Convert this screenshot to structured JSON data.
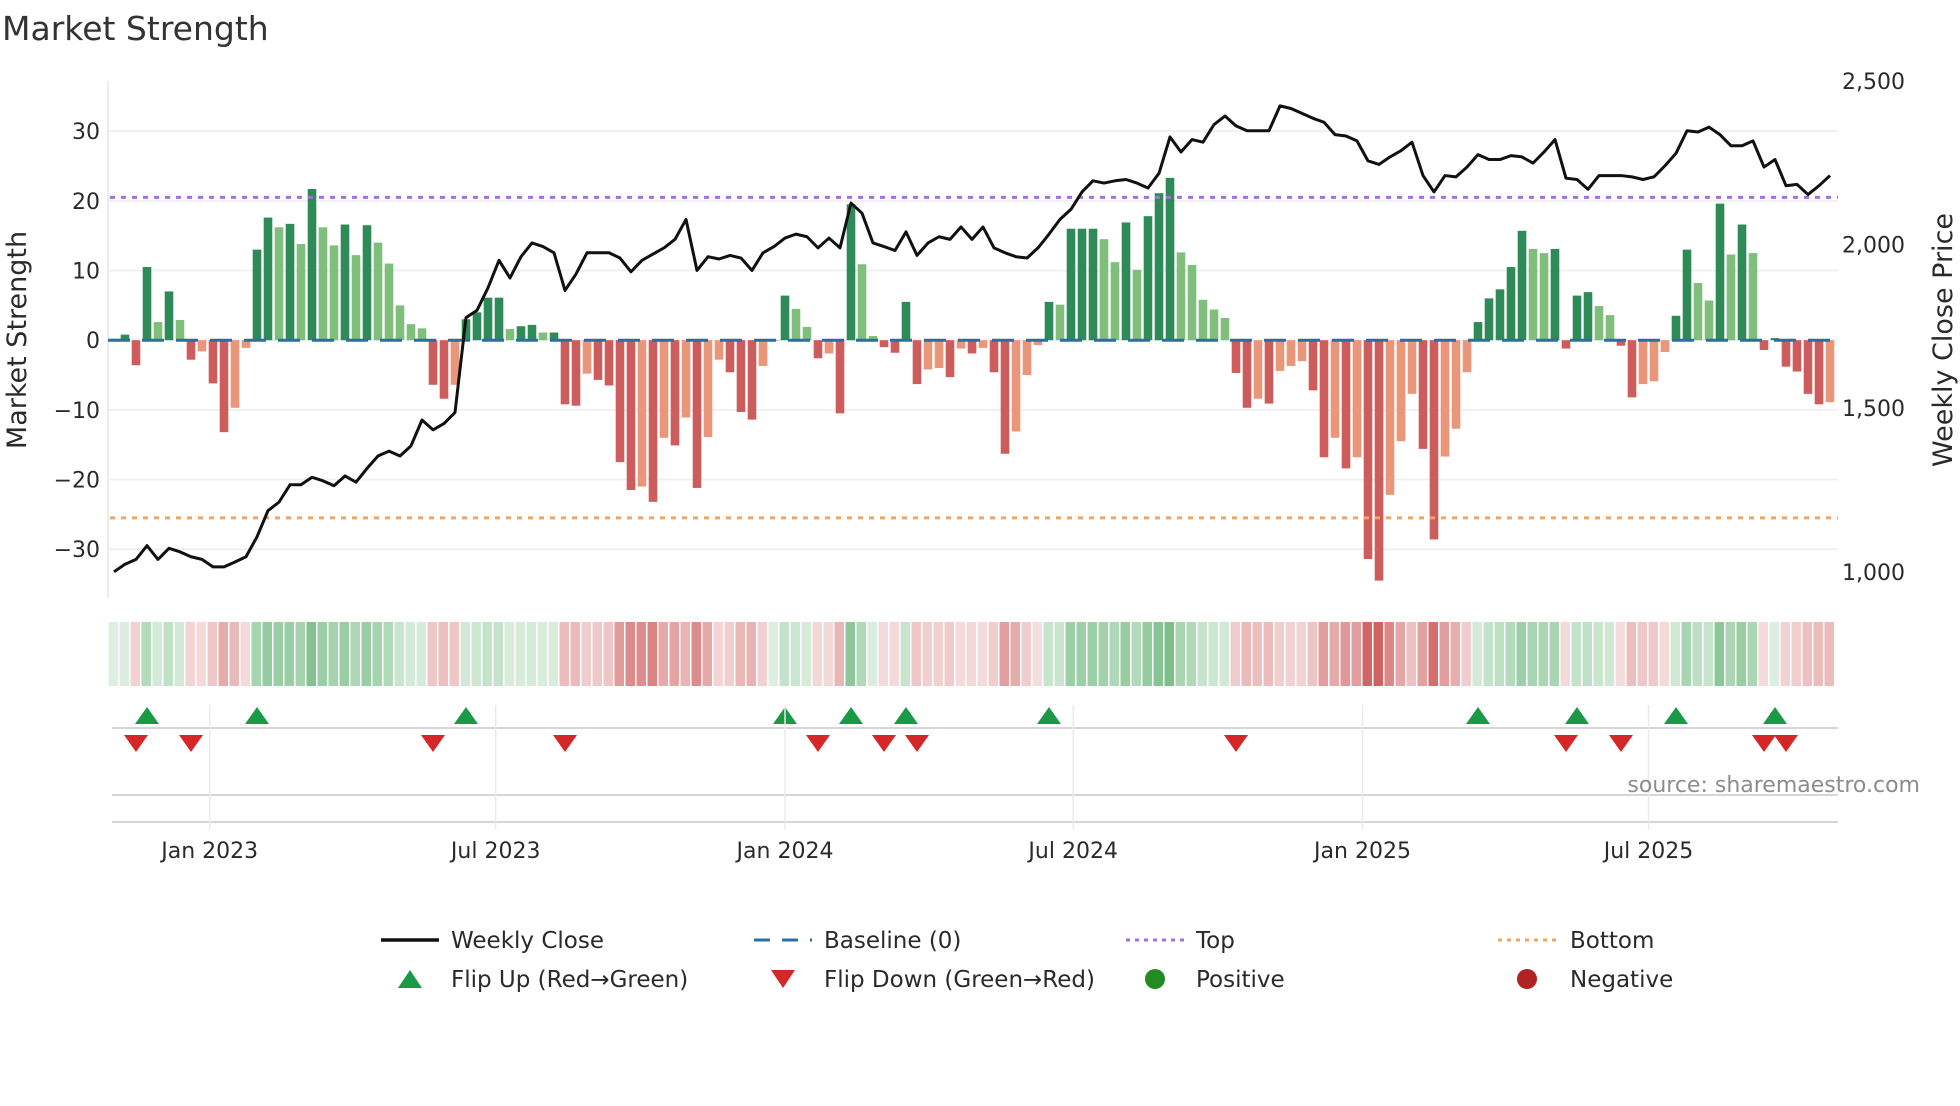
{
  "chart_data": {
    "type": "bar",
    "title": "Market Strength",
    "ylabel": "Market Strength",
    "y2label": "Weekly Close Price",
    "ylim": [
      -37,
      37.2
    ],
    "y2lim": [
      920,
      2500
    ],
    "yticks": [
      30,
      20,
      10,
      0,
      -10,
      -20,
      -30
    ],
    "ytick_labels": [
      "30",
      "20",
      "10",
      "0",
      "−10",
      "−20",
      "−30"
    ],
    "y2ticks": [
      2500,
      2000,
      1500,
      1000
    ],
    "y2tick_labels": [
      "2,500",
      "2,000",
      "1,500",
      "1,000"
    ],
    "x_unit": "week index (weekly bars, starting ~Nov 2022)",
    "xticks": [
      {
        "week": 8.7,
        "label": "Jan 2023"
      },
      {
        "week": 34.7,
        "label": "Jul 2023"
      },
      {
        "week": 61.0,
        "label": "Jan 2024"
      },
      {
        "week": 87.2,
        "label": "Jul 2024"
      },
      {
        "week": 113.5,
        "label": "Jan 2025"
      },
      {
        "week": 139.5,
        "label": "Jul 2025"
      }
    ],
    "top_level": 20.5,
    "bottom_level": -25.5,
    "baseline": 0,
    "strength": [
      0.2,
      0.8,
      -3.6,
      10.5,
      2.6,
      7,
      2.9,
      -2.8,
      -1.6,
      -6.2,
      -13.2,
      -9.7,
      -1.1,
      13,
      17.6,
      16.2,
      16.7,
      13.8,
      21.7,
      16.2,
      13.6,
      16.6,
      12.2,
      16.5,
      14,
      11,
      5,
      2.3,
      1.7,
      -6.4,
      -8.4,
      -6.4,
      3,
      4,
      6.1,
      6.1,
      1.6,
      2,
      2.2,
      1.1,
      1.1,
      -9.2,
      -9.4,
      -4.8,
      -5.7,
      -6.5,
      -17.5,
      -21.5,
      -21,
      -23.2,
      -14,
      -15.1,
      -11.1,
      -21.2,
      -13.9,
      -2.8,
      -4.6,
      -10.3,
      -11.4,
      -3.7,
      0,
      6.4,
      4.5,
      1.9,
      -2.6,
      -1.9,
      -10.5,
      19.5,
      10.9,
      0.6,
      -1,
      -1.8,
      5.5,
      -6.3,
      -4.2,
      -4,
      -5.3,
      -1.2,
      -1.9,
      -1.1,
      -4.6,
      -16.3,
      -13.1,
      -5,
      -0.7,
      5.5,
      5.1,
      16,
      16,
      16,
      14.5,
      11.2,
      16.9,
      10.1,
      17.8,
      21.1,
      23.3,
      12.6,
      10.8,
      5.8,
      4.4,
      3.2,
      -4.7,
      -9.7,
      -8.4,
      -9.1,
      -4.4,
      -3.7,
      -3,
      -7.2,
      -16.8,
      -14,
      -18.4,
      -16.8,
      -31.4,
      -34.5,
      -22.2,
      -14.5,
      -7.7,
      -15.6,
      -28.6,
      -16.7,
      -12.7,
      -4.6,
      2.6,
      6,
      7.3,
      10.5,
      15.7,
      13.1,
      12.5,
      13.1,
      -1.2,
      6.4,
      6.9,
      4.9,
      3.6,
      -0.8,
      -8.2,
      -6.3,
      -5.9,
      -1.7,
      3.5,
      13,
      8.2,
      5.7,
      19.6,
      12.3,
      16.6,
      12.5,
      -1.4,
      0.3,
      -3.8,
      -4.5,
      -7.7,
      -9.2,
      -8.9
    ],
    "weekly_close": [
      1000,
      1023,
      1038,
      1080,
      1038,
      1072,
      1061,
      1046,
      1038,
      1015,
      1015,
      1030,
      1046,
      1107,
      1187,
      1213,
      1266,
      1266,
      1289,
      1278,
      1263,
      1293,
      1274,
      1316,
      1354,
      1369,
      1354,
      1385,
      1464,
      1434,
      1453,
      1487,
      1777,
      1799,
      1868,
      1952,
      1898,
      1963,
      2005,
      1994,
      1975,
      1860,
      1910,
      1975,
      1975,
      1975,
      1959,
      1917,
      1952,
      1971,
      1990,
      2016,
      2077,
      1921,
      1963,
      1956,
      1967,
      1959,
      1921,
      1975,
      1994,
      2020,
      2032,
      2024,
      1990,
      2020,
      1990,
      2127,
      2096,
      2005,
      1994,
      1982,
      2039,
      1967,
      2005,
      2024,
      2016,
      2054,
      2016,
      2054,
      1990,
      1975,
      1963,
      1959,
      1990,
      2032,
      2077,
      2108,
      2161,
      2195,
      2188,
      2195,
      2199,
      2188,
      2173,
      2218,
      2329,
      2283,
      2321,
      2313,
      2367,
      2393,
      2363,
      2348,
      2348,
      2348,
      2424,
      2416,
      2401,
      2386,
      2374,
      2336,
      2332,
      2317,
      2256,
      2245,
      2268,
      2287,
      2313,
      2211,
      2161,
      2211,
      2207,
      2237,
      2275,
      2260,
      2260,
      2272,
      2268,
      2249,
      2283,
      2321,
      2203,
      2199,
      2169,
      2211,
      2211,
      2211,
      2207,
      2199,
      2207,
      2241,
      2279,
      2348,
      2344,
      2359,
      2336,
      2302,
      2302,
      2317,
      2237,
      2260,
      2180,
      2184,
      2153,
      2180,
      2211
    ],
    "legend": {
      "placement": "bottom",
      "items": [
        {
          "label": "Weekly Close",
          "symbol": "line",
          "color": "#111111"
        },
        {
          "label": "Baseline (0)",
          "symbol": "dash",
          "color": "#2b6f9e"
        },
        {
          "label": "Top",
          "symbol": "dot",
          "color": "#a66ee0"
        },
        {
          "label": "Bottom",
          "symbol": "dot",
          "color": "#f0a560"
        },
        {
          "label": "Flip Up (Red→Green)",
          "symbol": "triangle-up",
          "color": "#1a9a46"
        },
        {
          "label": "Flip Down (Green→Red)",
          "symbol": "triangle-down",
          "color": "#d62728"
        },
        {
          "label": "Positive",
          "symbol": "circle",
          "color": "#228b22"
        },
        {
          "label": "Negative",
          "symbol": "circle",
          "color": "#b22222"
        }
      ]
    },
    "colors": {
      "pos_strong": "#2e8b57",
      "pos_weak": "#7fbf7b",
      "neg_strong": "#cd5c5c",
      "neg_weak": "#e9967a",
      "grid": "#eef0f4"
    },
    "source": "source: sharemaestro.com"
  }
}
